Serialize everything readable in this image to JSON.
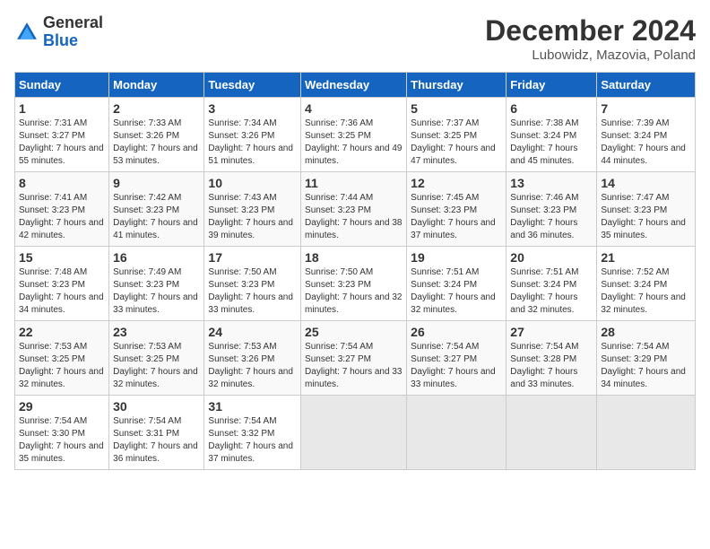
{
  "header": {
    "logo_line1": "General",
    "logo_line2": "Blue",
    "title": "December 2024",
    "subtitle": "Lubowidz, Mazovia, Poland"
  },
  "calendar": {
    "days_of_week": [
      "Sunday",
      "Monday",
      "Tuesday",
      "Wednesday",
      "Thursday",
      "Friday",
      "Saturday"
    ],
    "weeks": [
      [
        {
          "day": "1",
          "sunrise": "7:31 AM",
          "sunset": "3:27 PM",
          "daylight": "7 hours and 55 minutes."
        },
        {
          "day": "2",
          "sunrise": "7:33 AM",
          "sunset": "3:26 PM",
          "daylight": "7 hours and 53 minutes."
        },
        {
          "day": "3",
          "sunrise": "7:34 AM",
          "sunset": "3:26 PM",
          "daylight": "7 hours and 51 minutes."
        },
        {
          "day": "4",
          "sunrise": "7:36 AM",
          "sunset": "3:25 PM",
          "daylight": "7 hours and 49 minutes."
        },
        {
          "day": "5",
          "sunrise": "7:37 AM",
          "sunset": "3:25 PM",
          "daylight": "7 hours and 47 minutes."
        },
        {
          "day": "6",
          "sunrise": "7:38 AM",
          "sunset": "3:24 PM",
          "daylight": "7 hours and 45 minutes."
        },
        {
          "day": "7",
          "sunrise": "7:39 AM",
          "sunset": "3:24 PM",
          "daylight": "7 hours and 44 minutes."
        }
      ],
      [
        {
          "day": "8",
          "sunrise": "7:41 AM",
          "sunset": "3:23 PM",
          "daylight": "7 hours and 42 minutes."
        },
        {
          "day": "9",
          "sunrise": "7:42 AM",
          "sunset": "3:23 PM",
          "daylight": "7 hours and 41 minutes."
        },
        {
          "day": "10",
          "sunrise": "7:43 AM",
          "sunset": "3:23 PM",
          "daylight": "7 hours and 39 minutes."
        },
        {
          "day": "11",
          "sunrise": "7:44 AM",
          "sunset": "3:23 PM",
          "daylight": "7 hours and 38 minutes."
        },
        {
          "day": "12",
          "sunrise": "7:45 AM",
          "sunset": "3:23 PM",
          "daylight": "7 hours and 37 minutes."
        },
        {
          "day": "13",
          "sunrise": "7:46 AM",
          "sunset": "3:23 PM",
          "daylight": "7 hours and 36 minutes."
        },
        {
          "day": "14",
          "sunrise": "7:47 AM",
          "sunset": "3:23 PM",
          "daylight": "7 hours and 35 minutes."
        }
      ],
      [
        {
          "day": "15",
          "sunrise": "7:48 AM",
          "sunset": "3:23 PM",
          "daylight": "7 hours and 34 minutes."
        },
        {
          "day": "16",
          "sunrise": "7:49 AM",
          "sunset": "3:23 PM",
          "daylight": "7 hours and 33 minutes."
        },
        {
          "day": "17",
          "sunrise": "7:50 AM",
          "sunset": "3:23 PM",
          "daylight": "7 hours and 33 minutes."
        },
        {
          "day": "18",
          "sunrise": "7:50 AM",
          "sunset": "3:23 PM",
          "daylight": "7 hours and 32 minutes."
        },
        {
          "day": "19",
          "sunrise": "7:51 AM",
          "sunset": "3:24 PM",
          "daylight": "7 hours and 32 minutes."
        },
        {
          "day": "20",
          "sunrise": "7:51 AM",
          "sunset": "3:24 PM",
          "daylight": "7 hours and 32 minutes."
        },
        {
          "day": "21",
          "sunrise": "7:52 AM",
          "sunset": "3:24 PM",
          "daylight": "7 hours and 32 minutes."
        }
      ],
      [
        {
          "day": "22",
          "sunrise": "7:53 AM",
          "sunset": "3:25 PM",
          "daylight": "7 hours and 32 minutes."
        },
        {
          "day": "23",
          "sunrise": "7:53 AM",
          "sunset": "3:25 PM",
          "daylight": "7 hours and 32 minutes."
        },
        {
          "day": "24",
          "sunrise": "7:53 AM",
          "sunset": "3:26 PM",
          "daylight": "7 hours and 32 minutes."
        },
        {
          "day": "25",
          "sunrise": "7:54 AM",
          "sunset": "3:27 PM",
          "daylight": "7 hours and 33 minutes."
        },
        {
          "day": "26",
          "sunrise": "7:54 AM",
          "sunset": "3:27 PM",
          "daylight": "7 hours and 33 minutes."
        },
        {
          "day": "27",
          "sunrise": "7:54 AM",
          "sunset": "3:28 PM",
          "daylight": "7 hours and 33 minutes."
        },
        {
          "day": "28",
          "sunrise": "7:54 AM",
          "sunset": "3:29 PM",
          "daylight": "7 hours and 34 minutes."
        }
      ],
      [
        {
          "day": "29",
          "sunrise": "7:54 AM",
          "sunset": "3:30 PM",
          "daylight": "7 hours and 35 minutes."
        },
        {
          "day": "30",
          "sunrise": "7:54 AM",
          "sunset": "3:31 PM",
          "daylight": "7 hours and 36 minutes."
        },
        {
          "day": "31",
          "sunrise": "7:54 AM",
          "sunset": "3:32 PM",
          "daylight": "7 hours and 37 minutes."
        },
        null,
        null,
        null,
        null
      ]
    ]
  }
}
